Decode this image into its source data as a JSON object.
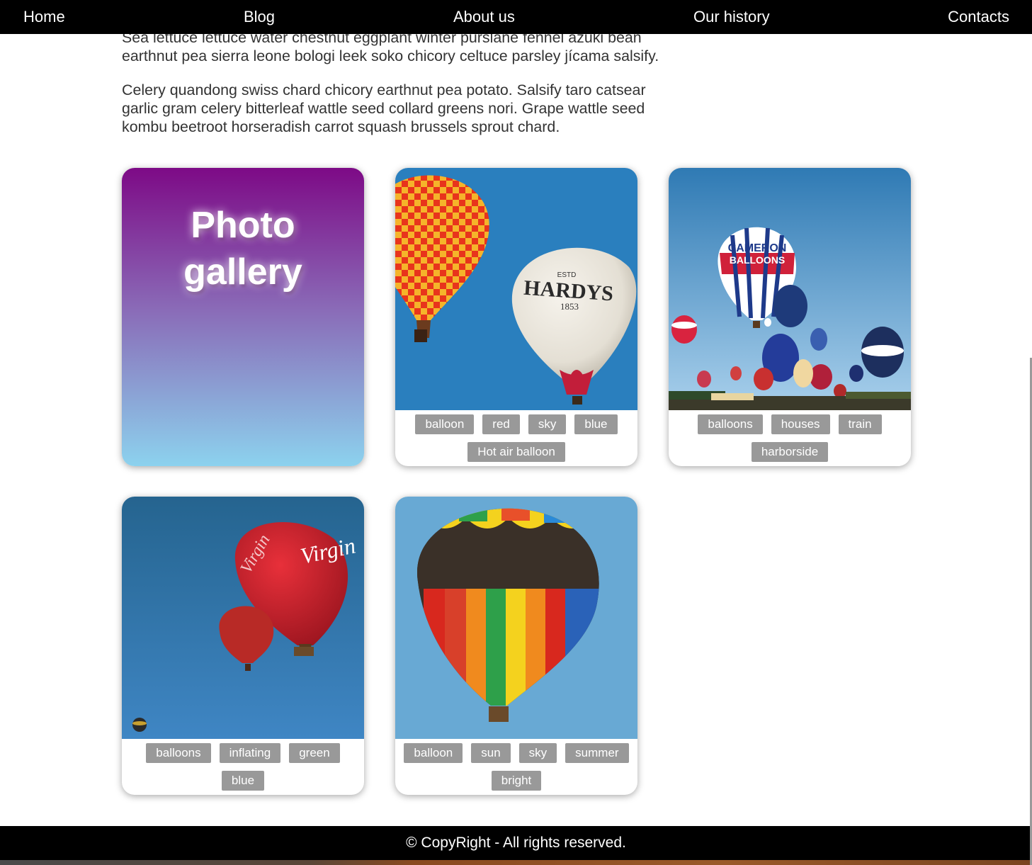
{
  "nav": {
    "items": [
      {
        "label": "Home"
      },
      {
        "label": "Blog"
      },
      {
        "label": "About us"
      },
      {
        "label": "Our history"
      },
      {
        "label": "Contacts"
      }
    ]
  },
  "content": {
    "paragraphs": [
      "Sea lettuce lettuce water chestnut eggplant winter purslane fennel azuki bean earthnut pea sierra leone bologi leek soko chicory celtuce parsley jícama salsify.",
      "Celery quandong swiss chard chicory earthnut pea potato. Salsify taro catsear garlic gram celery bitterleaf wattle seed collard greens nori. Grape wattle seed kombu beetroot horseradish carrot squash brussels sprout chard."
    ]
  },
  "gallery": {
    "title": "Photo gallery",
    "cards": [
      {
        "photo": "two-balloons-hardys",
        "tags": [
          "balloon",
          "red",
          "sky",
          "blue",
          "Hot air balloon"
        ]
      },
      {
        "photo": "many-balloons-festival",
        "tags": [
          "balloons",
          "houses",
          "train",
          "harborside"
        ]
      },
      {
        "photo": "red-virgin-balloons",
        "tags": [
          "balloons",
          "inflating",
          "green",
          "blue"
        ]
      },
      {
        "photo": "rainbow-balloon",
        "tags": [
          "balloon",
          "sun",
          "sky",
          "summer",
          "bright"
        ]
      }
    ]
  },
  "footer": {
    "text": "© CopyRight - All rights reserved."
  },
  "colors": {
    "nav_bg": "#000000",
    "tag_bg": "#999999",
    "gradient_top": "#7d0a86",
    "gradient_bottom": "#8cd2ee",
    "sky": "#2f86c4"
  }
}
